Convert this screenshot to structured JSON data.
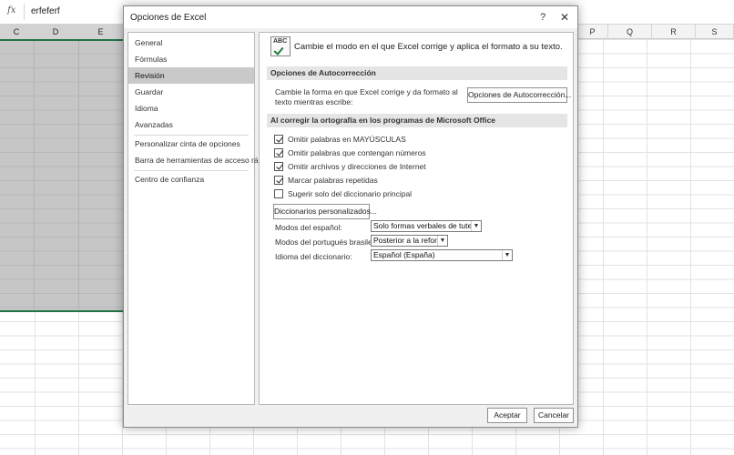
{
  "formula_bar": {
    "fx_label": "fx",
    "value": "erfeferf"
  },
  "columns": {
    "left": [
      "C",
      "D",
      "E"
    ],
    "right": [
      "P",
      "Q",
      "R",
      "S"
    ]
  },
  "dialog": {
    "title": "Opciones de Excel",
    "help_label": "?",
    "close_label": "✕",
    "nav": [
      "General",
      "Fórmulas",
      "Revisión",
      "Guardar",
      "Idioma",
      "Avanzadas",
      "Personalizar cinta de opciones",
      "Barra de herramientas de acceso rápido",
      "Centro de confianza"
    ],
    "active_nav": "Revisión",
    "icon_text": "ABC",
    "intro": "Cambie el modo en el que Excel corrige y aplica el formato a su texto.",
    "autocorrect": {
      "header": "Opciones de Autocorrección",
      "description": "Cambie la forma en que Excel corrige y da formato al texto mientras escribe:",
      "button": "Opciones de Autocorrección..."
    },
    "spelling": {
      "header": "Al corregir la ortografía en los programas de Microsoft Office",
      "checkboxes": [
        {
          "label": "Omitir palabras en MAYÚSCULAS",
          "checked": true
        },
        {
          "label": "Omitir palabras que contengan números",
          "checked": true
        },
        {
          "label": "Omitir archivos y direcciones de Internet",
          "checked": true
        },
        {
          "label": "Marcar palabras repetidas",
          "checked": true
        },
        {
          "label": "Sugerir solo del diccionario principal",
          "checked": false
        }
      ],
      "dictionaries_button": "Diccionarios personalizados...",
      "fields": [
        {
          "label": "Modos del español:",
          "value": "Solo formas verbales de tuteo"
        },
        {
          "label": "Modos del portugués brasileño:",
          "value": "Posterior a la reforma"
        },
        {
          "label": "Idioma del diccionario:",
          "value": "Español (España)"
        }
      ]
    },
    "ok_button": "Aceptar",
    "cancel_button": "Cancelar"
  }
}
